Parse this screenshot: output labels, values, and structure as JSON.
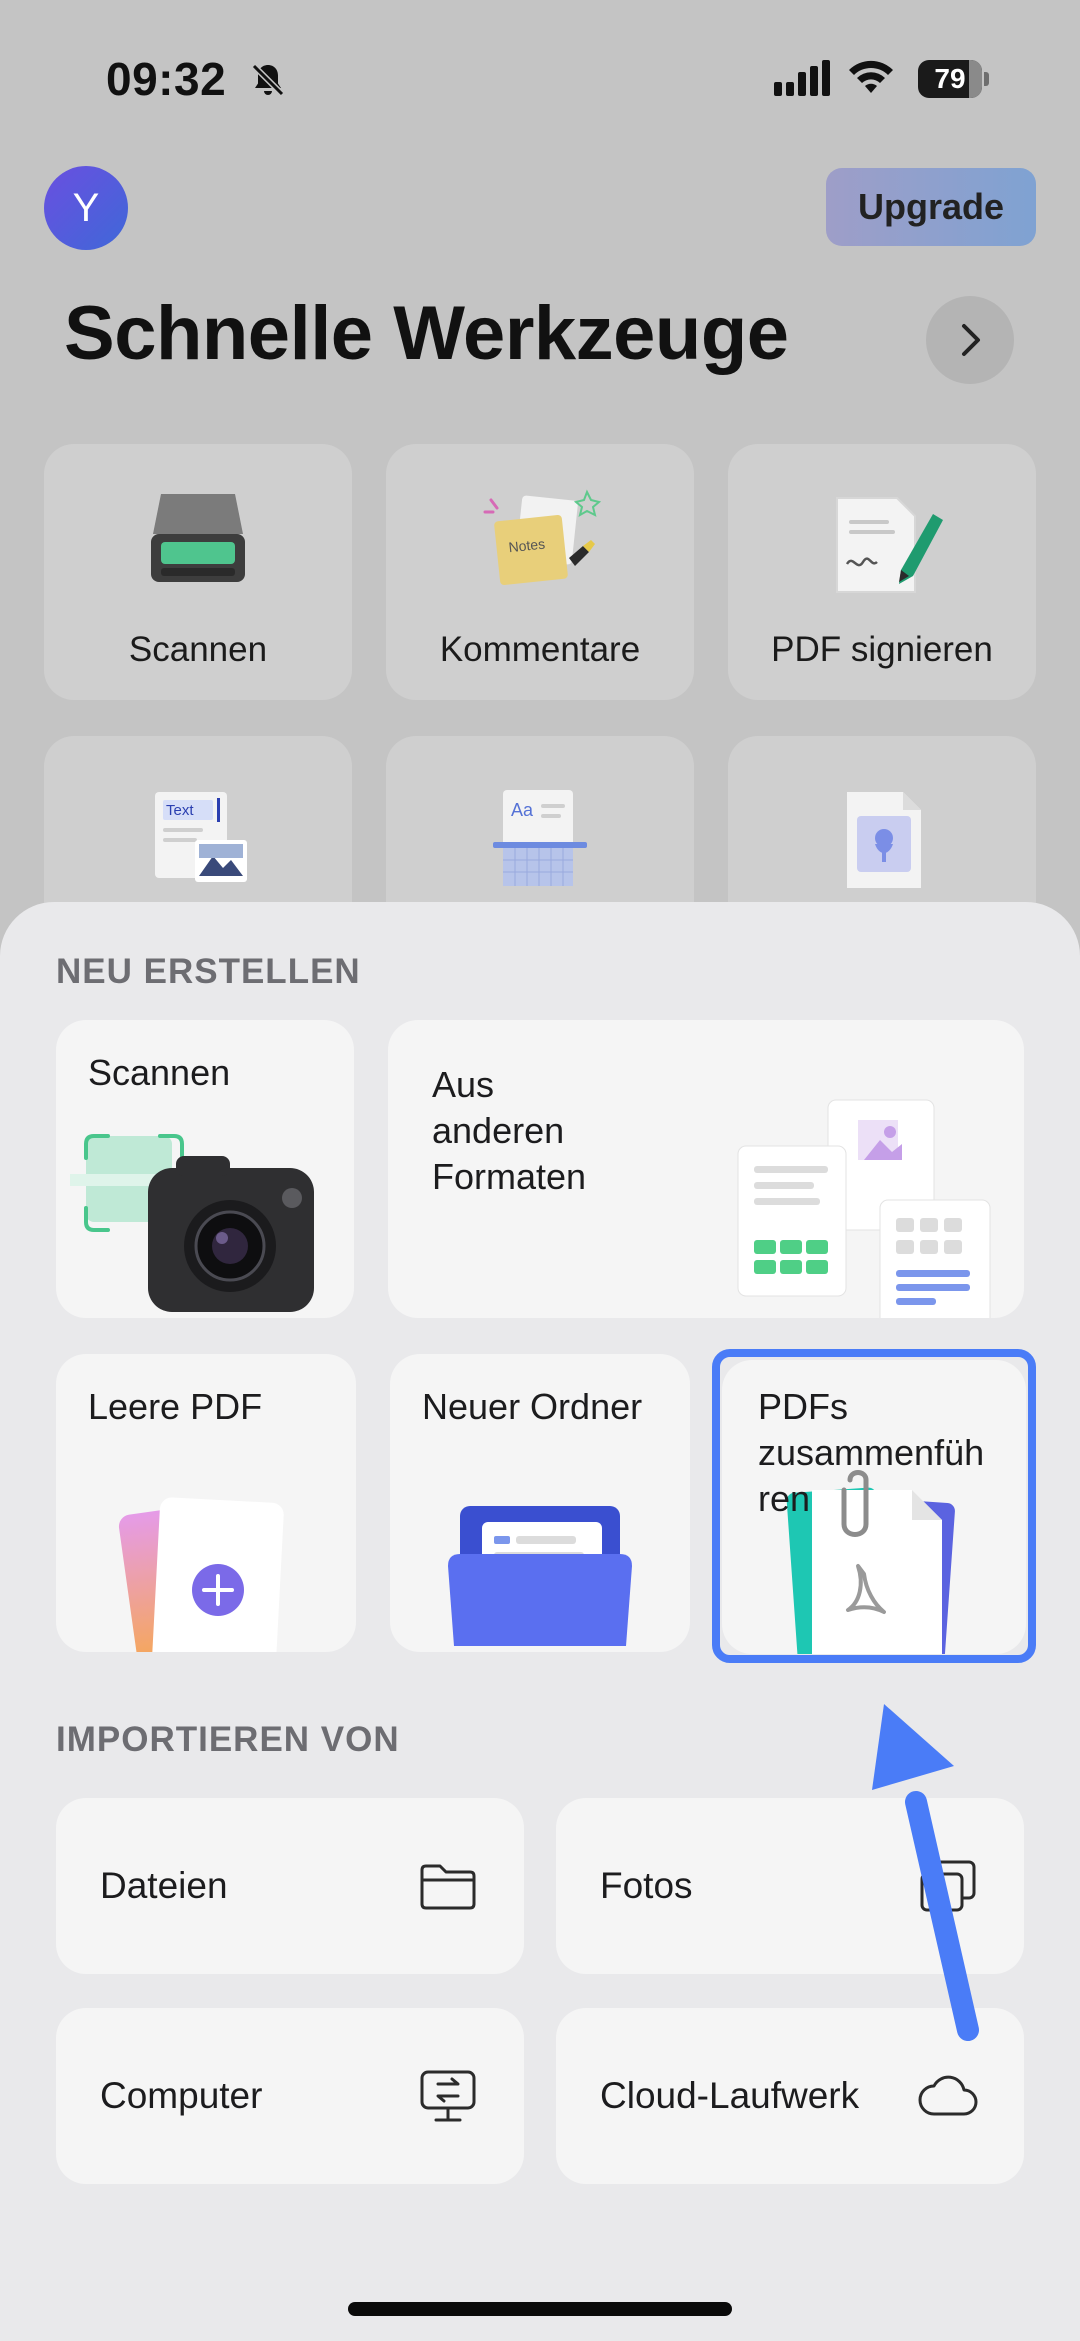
{
  "status_bar": {
    "time": "09:32",
    "battery": "79",
    "battery_level": 0.79
  },
  "header": {
    "avatar_letter": "Y",
    "upgrade_label": "Upgrade"
  },
  "quick_tools": {
    "title": "Schnelle Werkzeuge",
    "items": [
      {
        "label": "Scannen",
        "icon": "scanner-icon"
      },
      {
        "label": "Kommentare",
        "icon": "notes-icon"
      },
      {
        "label": "PDF signieren",
        "icon": "signature-icon"
      },
      {
        "label": "",
        "icon": "text-image-icon"
      },
      {
        "label": "",
        "icon": "ocr-icon"
      },
      {
        "label": "",
        "icon": "image-file-icon"
      }
    ]
  },
  "create_section": {
    "heading": "NEU ERSTELLEN",
    "scan": {
      "label": "Scannen",
      "icon": "camera-icon"
    },
    "formats": {
      "label": "Aus\nanderen\nFormaten",
      "icon": "documents-icon"
    },
    "blank": {
      "label": "Leere PDF",
      "icon": "blank-pdf-icon"
    },
    "folder": {
      "label": "Neuer Ordner",
      "icon": "folder-icon"
    },
    "merge": {
      "label": "PDFs\nzusammenfüh\nren",
      "icon": "merge-pdf-icon"
    }
  },
  "import_section": {
    "heading": "IMPORTIEREN VON",
    "items": [
      {
        "label": "Dateien",
        "icon": "folder-outline-icon"
      },
      {
        "label": "Fotos",
        "icon": "photos-icon"
      },
      {
        "label": "Computer",
        "icon": "computer-icon"
      },
      {
        "label": "Cloud-Laufwerk",
        "icon": "cloud-icon"
      }
    ]
  },
  "colors": {
    "accent": "#4a7cf7",
    "sheet": "#e9e9eb",
    "card": "#f5f5f5",
    "dim": "#c4c4c4"
  }
}
